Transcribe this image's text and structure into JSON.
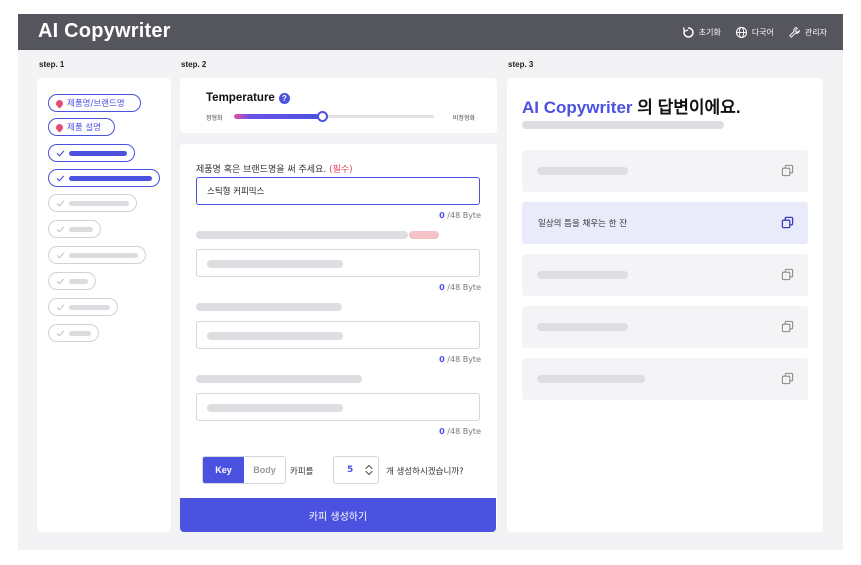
{
  "app": {
    "title": "AI Copywriter"
  },
  "header": {
    "actions": [
      {
        "label": "초기화",
        "icon": "reset-icon"
      },
      {
        "label": "다국어",
        "icon": "globe-icon"
      },
      {
        "label": "관리자",
        "icon": "wrench-icon"
      }
    ]
  },
  "steps": {
    "step1": "step. 1",
    "step2": "step. 2",
    "step3": "step. 3"
  },
  "step1": {
    "chips": [
      {
        "label": "제품명/브랜드명",
        "active": true,
        "type": "required"
      },
      {
        "label": "제품 설명",
        "active": true,
        "type": "required"
      },
      {
        "label": "",
        "active": true,
        "type": "check"
      },
      {
        "label": "",
        "active": true,
        "type": "check"
      },
      {
        "label": "",
        "active": false,
        "type": "check"
      },
      {
        "label": "",
        "active": false,
        "type": "check"
      },
      {
        "label": "",
        "active": false,
        "type": "check"
      },
      {
        "label": "",
        "active": false,
        "type": "check"
      },
      {
        "label": "",
        "active": false,
        "type": "check"
      },
      {
        "label": "",
        "active": false,
        "type": "check"
      }
    ]
  },
  "step2": {
    "temperature": {
      "title": "Temperature",
      "help": "?",
      "left_label": "정형화",
      "right_label": "비정형화",
      "value": 0.44
    },
    "form": {
      "label": "제품명 혹은 브랜드명을 써 주세요.",
      "required": "(필수)",
      "value": "스틱형 커피믹스",
      "byte_count": "0",
      "byte_max": " /48 Byte"
    },
    "extra_fields": [
      {
        "byte_count": "0",
        "byte_max": " /48 Byte"
      },
      {
        "byte_count": "0",
        "byte_max": " /48 Byte"
      },
      {
        "byte_count": "0",
        "byte_max": " /48 Byte"
      }
    ],
    "mode": {
      "key": "Key",
      "body": "Body",
      "selected": "Key"
    },
    "copy_label": "카피를",
    "count": "5",
    "count_suffix": "개 생성하시겠습니까?",
    "generate": "카피 생성하기"
  },
  "step3": {
    "title_brand": "AI Copywriter",
    "title_rest": " 의 답변이에요.",
    "results": [
      {
        "text": "",
        "highlighted": false
      },
      {
        "text": "일상의 틈을 채우는 한 잔",
        "highlighted": true
      },
      {
        "text": "",
        "highlighted": false
      },
      {
        "text": "",
        "highlighted": false
      },
      {
        "text": "",
        "highlighted": false
      }
    ]
  },
  "colors": {
    "accent": "#4b52e0",
    "header": "#55555d",
    "required": "#e0465a",
    "pin": "#e84a7a"
  }
}
